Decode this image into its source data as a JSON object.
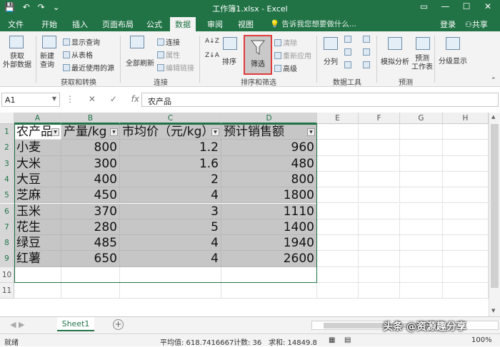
{
  "titlebar": {
    "doc_title": "工作簿1.xlsx - Excel",
    "qat": [
      "💾",
      "↶",
      "↷",
      "⌄"
    ],
    "controls": [
      "▭",
      "—",
      "☐",
      "✕"
    ]
  },
  "tabs": [
    "文件",
    "开始",
    "插入",
    "页面布局",
    "公式",
    "数据",
    "审阅",
    "视图"
  ],
  "active_tab": "数据",
  "tell_me": "告诉我您想要做什么...",
  "login": "登录",
  "share": "共享",
  "ribbon": {
    "get_external": "获取\n外部数据",
    "new_query": "新建\n查询",
    "show_query": "显示查询",
    "from_table": "从表格",
    "recent_sources": "最近使用的源",
    "group_get_transform": "获取和转换",
    "refresh_all": "全部刷新",
    "connections": "连接",
    "properties": "属性",
    "edit_links": "编辑链接",
    "group_connections": "连接",
    "sort_asc": "A↓Z",
    "sort_desc": "Z↓A",
    "sort": "排序",
    "filter": "筛选",
    "clear": "清除",
    "reapply": "重新应用",
    "advanced": "高级",
    "group_sort_filter": "排序和筛选",
    "text_to_columns": "分列",
    "group_data_tools": "数据工具",
    "what_if": "模拟分析",
    "forecast_sheet": "预测\n工作表",
    "group_forecast": "预测",
    "outline": "分级显示"
  },
  "formula_bar": {
    "name_box": "A1",
    "cancel": "✕",
    "enter": "✓",
    "fx": "fx",
    "value": "农产品"
  },
  "columns": [
    "A",
    "B",
    "C",
    "D",
    "E",
    "F",
    "G",
    "H"
  ],
  "rows": [
    "1",
    "2",
    "3",
    "4",
    "5",
    "6",
    "7",
    "8",
    "9",
    "10",
    "11"
  ],
  "table": {
    "headers": [
      "农产品",
      "产量/kg",
      "市均价（元/kg）",
      "预计销售额"
    ],
    "rows": [
      [
        "小麦",
        "800",
        "1.2",
        "960"
      ],
      [
        "大米",
        "300",
        "1.6",
        "480"
      ],
      [
        "大豆",
        "400",
        "2",
        "800"
      ],
      [
        "芝麻",
        "450",
        "4",
        "1800"
      ],
      [
        "玉米",
        "370",
        "3",
        "1110"
      ],
      [
        "花生",
        "280",
        "5",
        "1400"
      ],
      [
        "绿豆",
        "485",
        "4",
        "1940"
      ],
      [
        "红薯",
        "650",
        "4",
        "2600"
      ]
    ]
  },
  "sheet_tab": "Sheet1",
  "status": {
    "ready": "就绪",
    "average": "平均值: 618.7416667",
    "count": "计数: 36",
    "sum": "求和: 14849.8",
    "zoom": "100%"
  },
  "watermark": "头条 @资源趣分享",
  "colors": {
    "accent": "#217346",
    "filter_highlight": "#e23b3b"
  }
}
